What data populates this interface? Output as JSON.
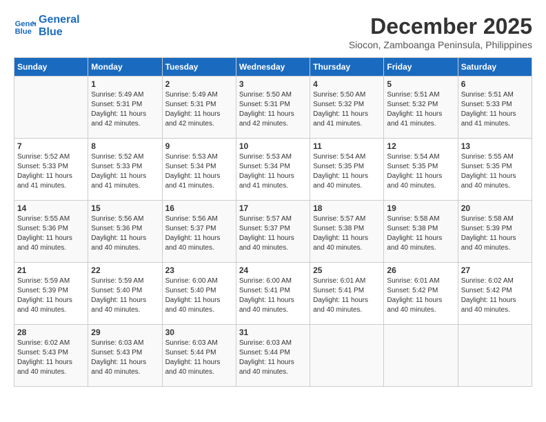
{
  "logo": {
    "line1": "General",
    "line2": "Blue"
  },
  "title": "December 2025",
  "subtitle": "Siocon, Zamboanga Peninsula, Philippines",
  "days_of_week": [
    "Sunday",
    "Monday",
    "Tuesday",
    "Wednesday",
    "Thursday",
    "Friday",
    "Saturday"
  ],
  "weeks": [
    [
      {
        "day": "",
        "sunrise": "",
        "sunset": "",
        "daylight": ""
      },
      {
        "day": "1",
        "sunrise": "Sunrise: 5:49 AM",
        "sunset": "Sunset: 5:31 PM",
        "daylight": "Daylight: 11 hours and 42 minutes."
      },
      {
        "day": "2",
        "sunrise": "Sunrise: 5:49 AM",
        "sunset": "Sunset: 5:31 PM",
        "daylight": "Daylight: 11 hours and 42 minutes."
      },
      {
        "day": "3",
        "sunrise": "Sunrise: 5:50 AM",
        "sunset": "Sunset: 5:31 PM",
        "daylight": "Daylight: 11 hours and 42 minutes."
      },
      {
        "day": "4",
        "sunrise": "Sunrise: 5:50 AM",
        "sunset": "Sunset: 5:32 PM",
        "daylight": "Daylight: 11 hours and 41 minutes."
      },
      {
        "day": "5",
        "sunrise": "Sunrise: 5:51 AM",
        "sunset": "Sunset: 5:32 PM",
        "daylight": "Daylight: 11 hours and 41 minutes."
      },
      {
        "day": "6",
        "sunrise": "Sunrise: 5:51 AM",
        "sunset": "Sunset: 5:33 PM",
        "daylight": "Daylight: 11 hours and 41 minutes."
      }
    ],
    [
      {
        "day": "7",
        "sunrise": "Sunrise: 5:52 AM",
        "sunset": "Sunset: 5:33 PM",
        "daylight": "Daylight: 11 hours and 41 minutes."
      },
      {
        "day": "8",
        "sunrise": "Sunrise: 5:52 AM",
        "sunset": "Sunset: 5:33 PM",
        "daylight": "Daylight: 11 hours and 41 minutes."
      },
      {
        "day": "9",
        "sunrise": "Sunrise: 5:53 AM",
        "sunset": "Sunset: 5:34 PM",
        "daylight": "Daylight: 11 hours and 41 minutes."
      },
      {
        "day": "10",
        "sunrise": "Sunrise: 5:53 AM",
        "sunset": "Sunset: 5:34 PM",
        "daylight": "Daylight: 11 hours and 41 minutes."
      },
      {
        "day": "11",
        "sunrise": "Sunrise: 5:54 AM",
        "sunset": "Sunset: 5:35 PM",
        "daylight": "Daylight: 11 hours and 40 minutes."
      },
      {
        "day": "12",
        "sunrise": "Sunrise: 5:54 AM",
        "sunset": "Sunset: 5:35 PM",
        "daylight": "Daylight: 11 hours and 40 minutes."
      },
      {
        "day": "13",
        "sunrise": "Sunrise: 5:55 AM",
        "sunset": "Sunset: 5:35 PM",
        "daylight": "Daylight: 11 hours and 40 minutes."
      }
    ],
    [
      {
        "day": "14",
        "sunrise": "Sunrise: 5:55 AM",
        "sunset": "Sunset: 5:36 PM",
        "daylight": "Daylight: 11 hours and 40 minutes."
      },
      {
        "day": "15",
        "sunrise": "Sunrise: 5:56 AM",
        "sunset": "Sunset: 5:36 PM",
        "daylight": "Daylight: 11 hours and 40 minutes."
      },
      {
        "day": "16",
        "sunrise": "Sunrise: 5:56 AM",
        "sunset": "Sunset: 5:37 PM",
        "daylight": "Daylight: 11 hours and 40 minutes."
      },
      {
        "day": "17",
        "sunrise": "Sunrise: 5:57 AM",
        "sunset": "Sunset: 5:37 PM",
        "daylight": "Daylight: 11 hours and 40 minutes."
      },
      {
        "day": "18",
        "sunrise": "Sunrise: 5:57 AM",
        "sunset": "Sunset: 5:38 PM",
        "daylight": "Daylight: 11 hours and 40 minutes."
      },
      {
        "day": "19",
        "sunrise": "Sunrise: 5:58 AM",
        "sunset": "Sunset: 5:38 PM",
        "daylight": "Daylight: 11 hours and 40 minutes."
      },
      {
        "day": "20",
        "sunrise": "Sunrise: 5:58 AM",
        "sunset": "Sunset: 5:39 PM",
        "daylight": "Daylight: 11 hours and 40 minutes."
      }
    ],
    [
      {
        "day": "21",
        "sunrise": "Sunrise: 5:59 AM",
        "sunset": "Sunset: 5:39 PM",
        "daylight": "Daylight: 11 hours and 40 minutes."
      },
      {
        "day": "22",
        "sunrise": "Sunrise: 5:59 AM",
        "sunset": "Sunset: 5:40 PM",
        "daylight": "Daylight: 11 hours and 40 minutes."
      },
      {
        "day": "23",
        "sunrise": "Sunrise: 6:00 AM",
        "sunset": "Sunset: 5:40 PM",
        "daylight": "Daylight: 11 hours and 40 minutes."
      },
      {
        "day": "24",
        "sunrise": "Sunrise: 6:00 AM",
        "sunset": "Sunset: 5:41 PM",
        "daylight": "Daylight: 11 hours and 40 minutes."
      },
      {
        "day": "25",
        "sunrise": "Sunrise: 6:01 AM",
        "sunset": "Sunset: 5:41 PM",
        "daylight": "Daylight: 11 hours and 40 minutes."
      },
      {
        "day": "26",
        "sunrise": "Sunrise: 6:01 AM",
        "sunset": "Sunset: 5:42 PM",
        "daylight": "Daylight: 11 hours and 40 minutes."
      },
      {
        "day": "27",
        "sunrise": "Sunrise: 6:02 AM",
        "sunset": "Sunset: 5:42 PM",
        "daylight": "Daylight: 11 hours and 40 minutes."
      }
    ],
    [
      {
        "day": "28",
        "sunrise": "Sunrise: 6:02 AM",
        "sunset": "Sunset: 5:43 PM",
        "daylight": "Daylight: 11 hours and 40 minutes."
      },
      {
        "day": "29",
        "sunrise": "Sunrise: 6:03 AM",
        "sunset": "Sunset: 5:43 PM",
        "daylight": "Daylight: 11 hours and 40 minutes."
      },
      {
        "day": "30",
        "sunrise": "Sunrise: 6:03 AM",
        "sunset": "Sunset: 5:44 PM",
        "daylight": "Daylight: 11 hours and 40 minutes."
      },
      {
        "day": "31",
        "sunrise": "Sunrise: 6:03 AM",
        "sunset": "Sunset: 5:44 PM",
        "daylight": "Daylight: 11 hours and 40 minutes."
      },
      {
        "day": "",
        "sunrise": "",
        "sunset": "",
        "daylight": ""
      },
      {
        "day": "",
        "sunrise": "",
        "sunset": "",
        "daylight": ""
      },
      {
        "day": "",
        "sunrise": "",
        "sunset": "",
        "daylight": ""
      }
    ]
  ]
}
